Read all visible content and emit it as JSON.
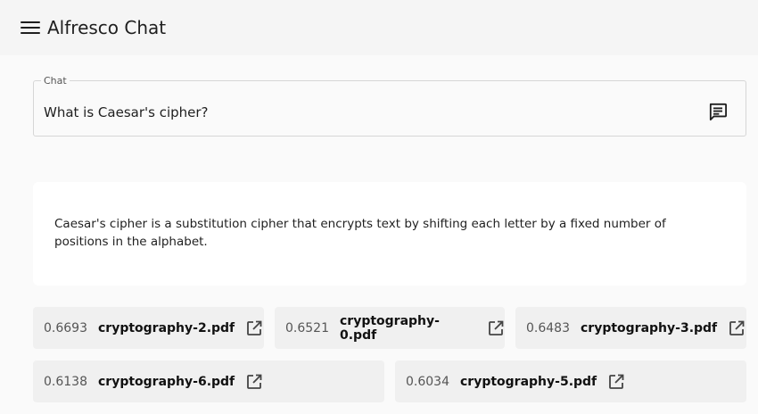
{
  "app": {
    "title": "Alfresco Chat"
  },
  "chat": {
    "label": "Chat",
    "value": "What is Caesar's cipher?"
  },
  "answer": {
    "text": "Caesar's cipher is a substitution cipher that encrypts text by shifting each letter by a fixed number of positions in the alphabet."
  },
  "sources": [
    {
      "score": "0.6693",
      "file": "cryptography-2.pdf"
    },
    {
      "score": "0.6521",
      "file": "cryptography-0.pdf"
    },
    {
      "score": "0.6483",
      "file": "cryptography-3.pdf"
    },
    {
      "score": "0.6138",
      "file": "cryptography-6.pdf"
    },
    {
      "score": "0.6034",
      "file": "cryptography-5.pdf"
    }
  ],
  "icons": {
    "menu": "menu-icon",
    "send": "chat-bubble-icon",
    "open": "open-in-new-icon"
  }
}
